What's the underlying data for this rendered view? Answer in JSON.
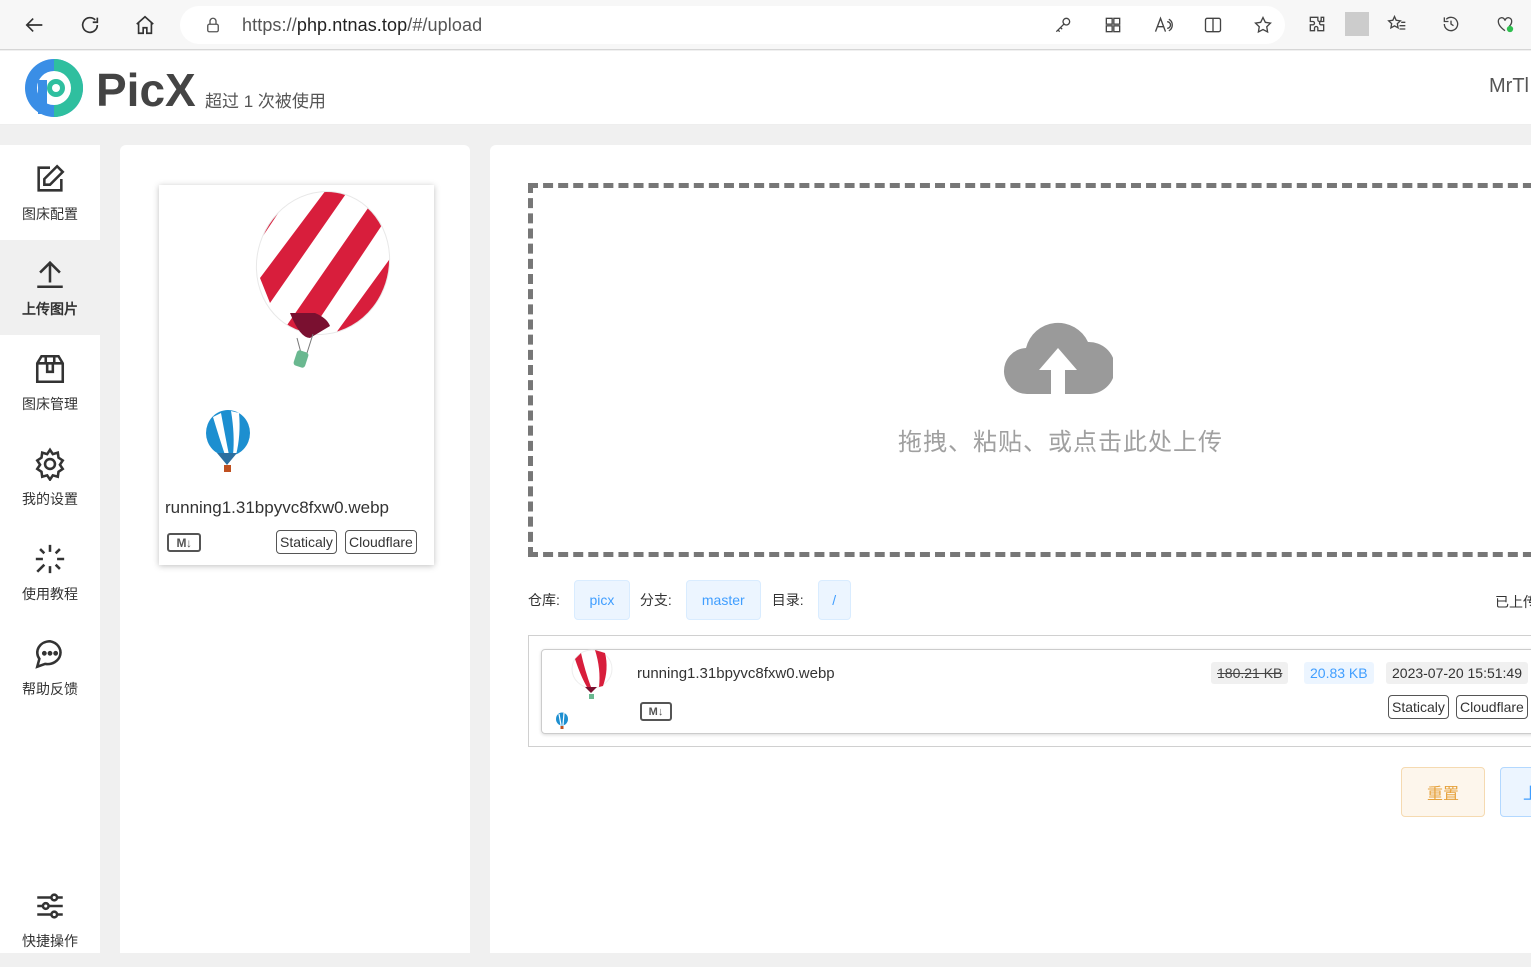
{
  "browser": {
    "url_prefix": "https://",
    "url_host": "php.ntnas.top",
    "url_path": "/#/upload"
  },
  "header": {
    "brand": "PicX",
    "usage_text": "超过 1 次被使用",
    "user_name": "MrTl"
  },
  "sidebar": {
    "items": [
      {
        "label": "图床配置",
        "icon": "edit-icon"
      },
      {
        "label": "上传图片",
        "icon": "upload-icon",
        "active": true
      },
      {
        "label": "图床管理",
        "icon": "box-icon"
      },
      {
        "label": "我的设置",
        "icon": "gear-icon"
      },
      {
        "label": "使用教程",
        "icon": "sparkle-icon"
      },
      {
        "label": "帮助反馈",
        "icon": "chat-icon"
      },
      {
        "label": "快捷操作",
        "icon": "sliders-icon"
      }
    ]
  },
  "preview": {
    "file_name": "running1.31bpyvc8fxw0.webp",
    "md_label": "M↓",
    "cdn_1": "Staticaly",
    "cdn_2": "Cloudflare"
  },
  "upload": {
    "drop_text": "拖拽、粘贴、或点击此处上传",
    "repo_label": "仓库:",
    "repo_value": "picx",
    "branch_label": "分支:",
    "branch_value": "master",
    "dir_label": "目录:",
    "dir_value": "/",
    "uploaded_label": "已上传"
  },
  "list": {
    "items": [
      {
        "name": "running1.31bpyvc8fxw0.webp",
        "md_label": "M↓",
        "original_size": "180.21 KB",
        "compressed_size": "20.83 KB",
        "time": "2023-07-20 15:51:49",
        "cdn_1": "Staticaly",
        "cdn_2": "Cloudflare"
      }
    ]
  },
  "buttons": {
    "reset": "重置",
    "upload": "上传"
  },
  "colors": {
    "accent": "#409eff",
    "warning": "#e6a23c",
    "logo_blue": "#3a8ee6",
    "logo_green": "#2fbf9f"
  }
}
